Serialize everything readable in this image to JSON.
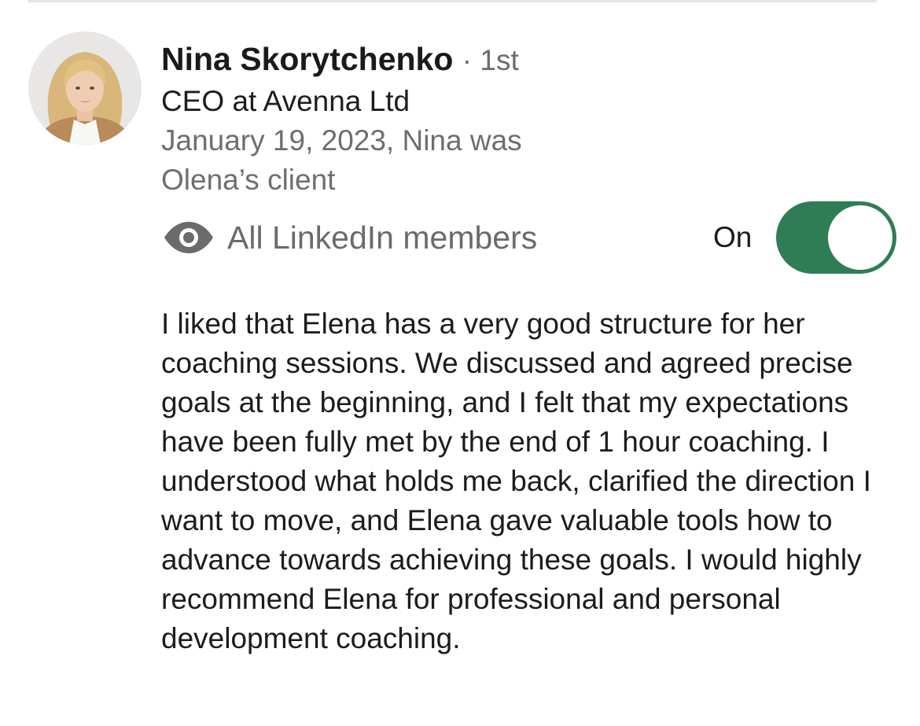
{
  "recommendation": {
    "author": {
      "name": "Nina Skorytchenko",
      "degree": "· 1st",
      "headline": "CEO at Avenna Ltd",
      "meta": "January 19, 2023, Nina was Olena’s client",
      "avatar_icon": "profile-photo"
    },
    "visibility": {
      "icon": "eye-icon",
      "label": "All LinkedIn members",
      "toggle_label": "On",
      "toggle_on": true,
      "toggle_color": "#2f7d55"
    },
    "text": "I liked that Elena has a very good structure for her coaching sessions. We discussed and agreed precise goals at the beginning, and I felt that my expectations have been fully met by the end of 1 hour coaching. I understood what holds me back, clarified the direction I want to move, and Elena gave valuable tools how to advance towards achieving these goals. I would highly recommend Elena for professional and personal development coaching."
  }
}
